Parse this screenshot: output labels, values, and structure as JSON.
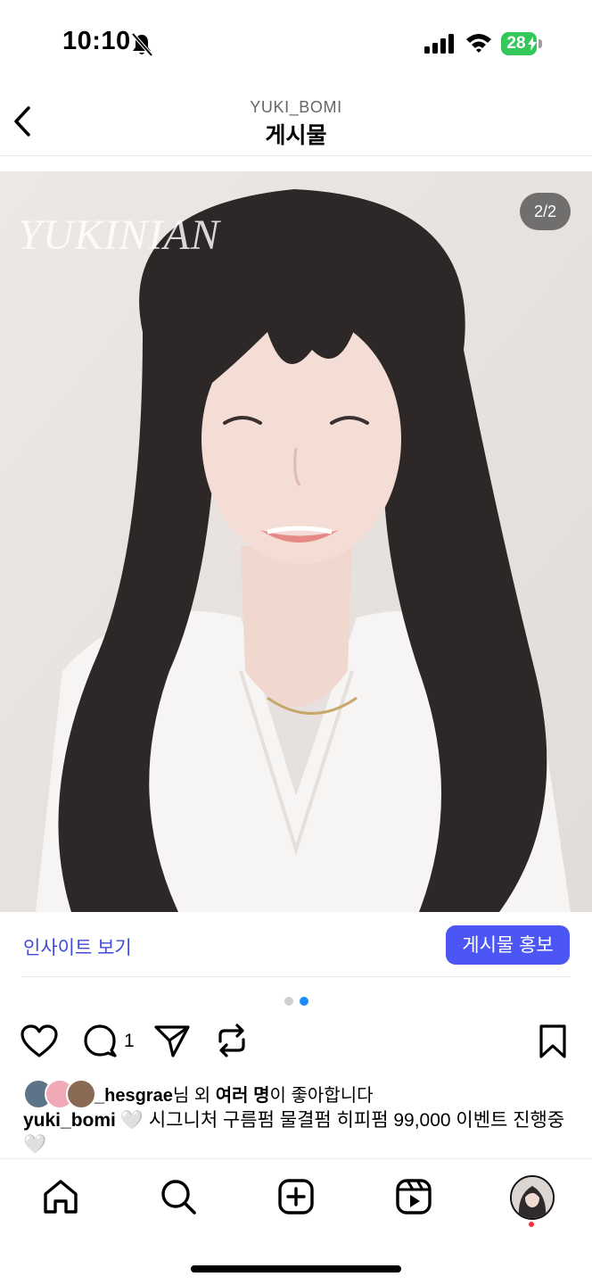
{
  "status_bar": {
    "time": "10:10",
    "battery_percent": "28",
    "battery_charging": true,
    "silent_mode": true
  },
  "header": {
    "username": "YUKI_BOMI",
    "title": "게시물"
  },
  "post": {
    "watermark": "YUKINIAN",
    "page_counter": "2/2",
    "carousel_active_index": 2,
    "carousel_total": 2
  },
  "insights": {
    "link_label": "인사이트 보기",
    "promote_label": "게시물 홍보"
  },
  "actions": {
    "comment_count": "1"
  },
  "likes": {
    "username": "_hesgrae",
    "text_mid": "님 외 ",
    "bold_part": "여러 명",
    "text_end": "이 좋아합니다"
  },
  "caption": {
    "username": "yuki_bomi",
    "text": "🤍 시그니처 구름펌 물결펌 히피펌 99,000 이벤트 진행중🤍"
  },
  "colors": {
    "accent": "#4b56f5",
    "link": "#3f4bd9",
    "carousel_active": "#1a8cff",
    "notification": "#ff2d37",
    "battery": "#34c759"
  },
  "icons": {
    "nav": [
      "home-icon",
      "search-icon",
      "create-icon",
      "reels-icon",
      "profile-avatar"
    ],
    "actions": [
      "heart-icon",
      "comment-icon",
      "share-icon",
      "repost-icon",
      "bookmark-icon"
    ]
  }
}
